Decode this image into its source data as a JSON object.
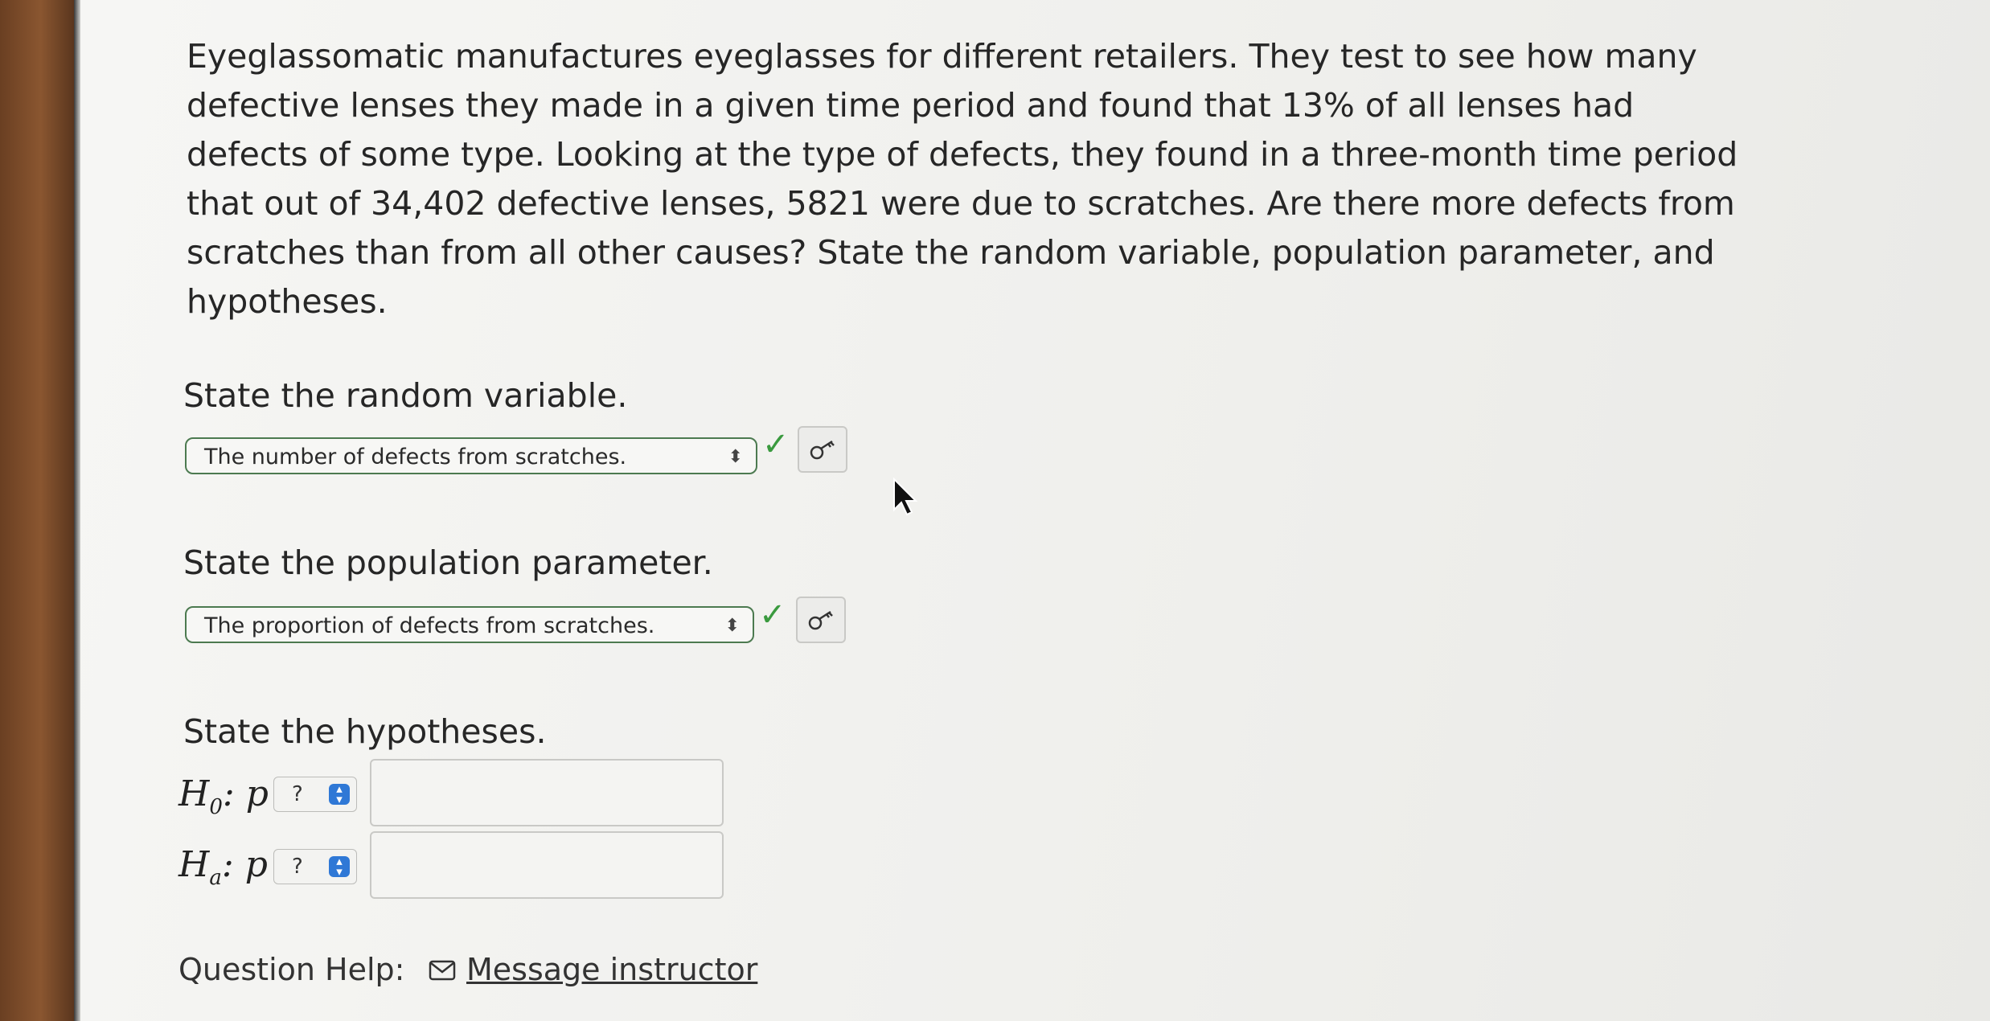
{
  "question": {
    "prompt": "Eyeglassomatic manufactures eyeglasses for different retailers. They test to see how many defective lenses they made in a given time period and found that 13% of all lenses had defects of some type. Looking at the type of defects, they found in a three-month time period that out of 34,402 defective lenses, 5821 were due to scratches. Are there more defects from scratches than from all other causes? State the random variable, population parameter, and hypotheses."
  },
  "random_variable": {
    "label": "State the random variable.",
    "selected": "The number of defects from scratches.",
    "status": "correct"
  },
  "population_parameter": {
    "label": "State the population parameter.",
    "selected": "The proportion of defects from scratches.",
    "status": "correct"
  },
  "hypotheses": {
    "label": "State the hypotheses.",
    "null": {
      "symbol": "H",
      "sub": "0",
      "suffix": ": p",
      "operator": "?",
      "value": ""
    },
    "alt": {
      "symbol": "H",
      "sub": "a",
      "suffix": ": p",
      "operator": "?",
      "value": ""
    }
  },
  "help": {
    "label": "Question Help:",
    "link": "Message instructor"
  },
  "icons": {
    "dropdown": "up-down-arrows-icon",
    "correct": "checkmark-icon",
    "answer_key": "key-icon",
    "mail": "envelope-icon",
    "cursor": "mouse-pointer-icon"
  },
  "colors": {
    "correct": "#3a9a3e",
    "stepper": "#2f78d6",
    "select_border": "#4c7a50"
  }
}
